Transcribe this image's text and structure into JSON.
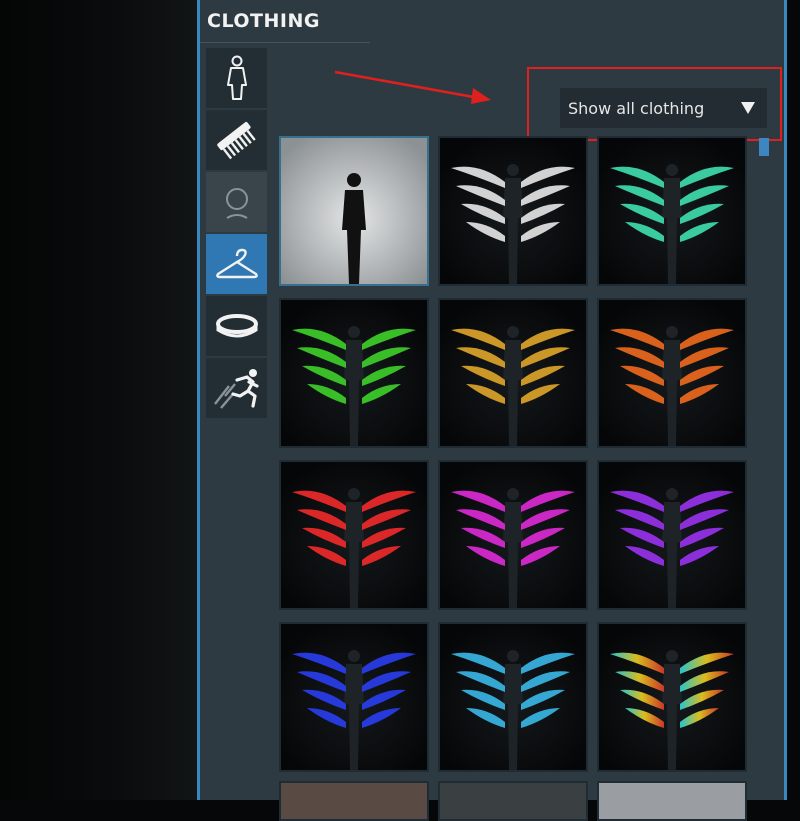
{
  "panel": {
    "title": "CLOTHING"
  },
  "side_tabs": [
    {
      "icon": "body-figure-icon"
    },
    {
      "icon": "comb-icon"
    },
    {
      "icon": "face-outline-icon"
    },
    {
      "icon": "clothes-hanger-icon",
      "active": true
    },
    {
      "icon": "ring-icon"
    },
    {
      "icon": "running-figure-icon"
    }
  ],
  "filter": {
    "selected": "Show all clothing"
  },
  "accent_colors": {
    "frame": "#3a88c0",
    "highlight": "#e0201e",
    "active_tab": "#2f78b4"
  },
  "items": [
    {
      "name": "mannequin-silhouette",
      "color": "#b0b4b6"
    },
    {
      "name": "white-wings",
      "color": "#e8e8e8"
    },
    {
      "name": "mint-wings",
      "color": "#3fe0b0"
    },
    {
      "name": "green-wings",
      "color": "#3ed22a"
    },
    {
      "name": "gold-wings",
      "color": "#e0a62a"
    },
    {
      "name": "orange-wings",
      "color": "#f06a1e"
    },
    {
      "name": "red-wings",
      "color": "#f22a2a"
    },
    {
      "name": "magenta-wings",
      "color": "#e02ad8"
    },
    {
      "name": "purple-wings",
      "color": "#9a32f0"
    },
    {
      "name": "blue-wings",
      "color": "#2a3ef0"
    },
    {
      "name": "cyan-wings",
      "color": "#3ab8e8"
    },
    {
      "name": "rainbow-wings",
      "color": "#e8b020"
    }
  ]
}
